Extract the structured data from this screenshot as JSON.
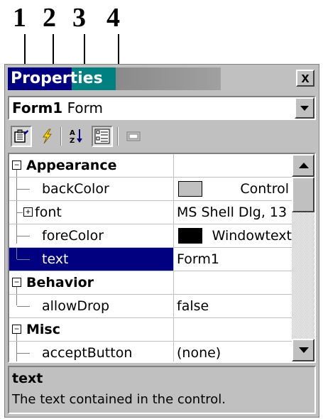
{
  "callouts": [
    "1",
    "2",
    "3",
    "4"
  ],
  "window": {
    "title": "Properties",
    "close_label": "x"
  },
  "object_selector": {
    "name": "Form1",
    "type": "Form"
  },
  "toolbar": {
    "buttons": [
      {
        "icon": "properties-page-icon",
        "pressed": true
      },
      {
        "icon": "events-lightning-icon",
        "pressed": false
      },
      {
        "icon": "sort-alphabetical-icon",
        "pressed": false
      },
      {
        "icon": "categorized-view-icon",
        "pressed": true
      },
      {
        "icon": "property-pages-icon",
        "pressed": false
      }
    ]
  },
  "grid": {
    "categories": [
      {
        "label": "Appearance",
        "expander": "−"
      },
      {
        "label": "Behavior",
        "expander": "−"
      },
      {
        "label": "Misc",
        "expander": "−"
      }
    ],
    "properties": {
      "backColor": {
        "name": "backColor",
        "value": "Control",
        "swatch": "#c0c0c0"
      },
      "font": {
        "name": "font",
        "value": "MS Shell Dlg, 13",
        "expander": "+"
      },
      "foreColor": {
        "name": "foreColor",
        "value": "Windowtext",
        "swatch": "#000000"
      },
      "text": {
        "name": "text",
        "value": "Form1",
        "selected": true
      },
      "allowDrop": {
        "name": "allowDrop",
        "value": "false"
      },
      "acceptButton": {
        "name": "acceptButton",
        "value": "(none)"
      }
    }
  },
  "description": {
    "title": "text",
    "text": "The text contained in the control."
  },
  "colors": {
    "selection": "#000080",
    "title_active": "#000080",
    "title_accent": "#008080",
    "face": "#c0c0c0"
  }
}
